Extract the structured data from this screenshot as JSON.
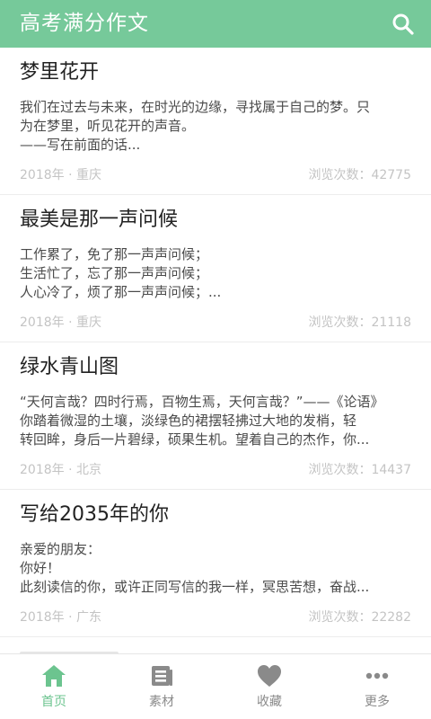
{
  "header": {
    "title": "高考满分作文"
  },
  "articles": [
    {
      "title": "梦里花开",
      "excerpt": [
        "我们在过去与未来，在时光的边缘，寻找属于自己的梦。只",
        "为在梦里，听见花开的声音。",
        "——写在前面的话..."
      ],
      "meta_left": "2018年 · 重庆",
      "meta_right": "浏览次数：42775"
    },
    {
      "title": "最美是那一声问候",
      "excerpt": [
        "工作累了，免了那一声声问候；",
        "生活忙了，忘了那一声声问候；",
        "人心冷了，烦了那一声声问候；..."
      ],
      "meta_left": "2018年 · 重庆",
      "meta_right": "浏览次数：21118"
    },
    {
      "title": "绿水青山图",
      "excerpt": [
        "“天何言哉？四时行焉，百物生焉，天何言哉？”——《论语》",
        " 你踏着微湿的土壤，淡绿色的裙摆轻拂过大地的发梢，轻",
        "转回眸，身后一片碧绿，硕果生机。望着自己的杰作，你..."
      ],
      "meta_left": "2018年 · 北京",
      "meta_right": "浏览次数：14437"
    },
    {
      "title": "写给2035年的你",
      "excerpt": [
        "亲爱的朋友：",
        " 你好！",
        " 此刻读信的你，或许正同写信的我一样，冥思苦想，奋战..."
      ],
      "meta_left": "2018年 · 广东",
      "meta_right": "浏览次数：22282"
    }
  ],
  "bottom_nav": [
    {
      "label": "首页",
      "icon": "home-icon",
      "active": true
    },
    {
      "label": "素材",
      "icon": "book-icon",
      "active": false
    },
    {
      "label": "收藏",
      "icon": "heart-icon",
      "active": false
    },
    {
      "label": "更多",
      "icon": "more-icon",
      "active": false
    }
  ],
  "colors": {
    "primary": "#76c99a",
    "active_nav": "#6cc48f",
    "inactive_nav": "#8a8a8a",
    "meta_text": "#c4c4c4"
  }
}
